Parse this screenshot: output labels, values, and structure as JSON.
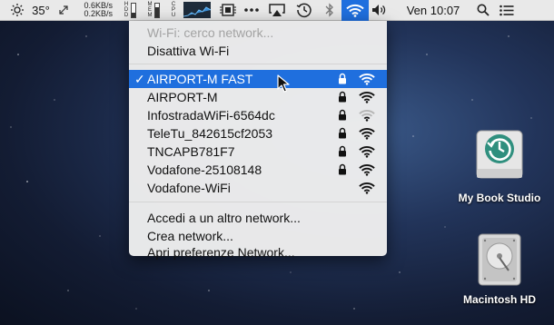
{
  "menubar": {
    "weather_temp": "35°",
    "net_up": "0.6KB/s",
    "net_down": "0.2KB/s",
    "clock": "Ven 10:07",
    "icons": [
      "sun-icon",
      "arrows-icon",
      "cpu-meters",
      "memory-meter",
      "cpu-graph",
      "chip-icon",
      "more-icon",
      "airplay-icon",
      "time-machine-icon",
      "bluetooth-icon",
      "wifi-icon",
      "volume-icon",
      "search-icon",
      "list-icon"
    ]
  },
  "wifi_menu": {
    "status": "Wi-Fi: cerco network...",
    "toggle_label": "Disattiva Wi-Fi",
    "networks": [
      {
        "name": "AIRPORT-M FAST",
        "selected": true,
        "locked": true,
        "signal": "full"
      },
      {
        "name": "AIRPORT-M",
        "selected": false,
        "locked": true,
        "signal": "full"
      },
      {
        "name": "InfostradaWiFi-6564dc",
        "selected": false,
        "locked": true,
        "signal": "weak"
      },
      {
        "name": "TeleTu_842615cf2053",
        "selected": false,
        "locked": true,
        "signal": "full"
      },
      {
        "name": "TNCAPB781F7",
        "selected": false,
        "locked": true,
        "signal": "full"
      },
      {
        "name": "Vodafone-25108148",
        "selected": false,
        "locked": true,
        "signal": "full"
      },
      {
        "name": "Vodafone-WiFi",
        "selected": false,
        "locked": false,
        "signal": "full"
      }
    ],
    "check_mark": "✓",
    "join_other": "Accedi a un altro network...",
    "create_network": "Crea network...",
    "open_prefs": "Apri preferenze Network..."
  },
  "desktop": {
    "icon1_label": "My Book Studio",
    "icon2_label": "Macintosh HD"
  },
  "colors": {
    "selection": "#1f6fde",
    "menu_bg": "#eeeeee"
  }
}
